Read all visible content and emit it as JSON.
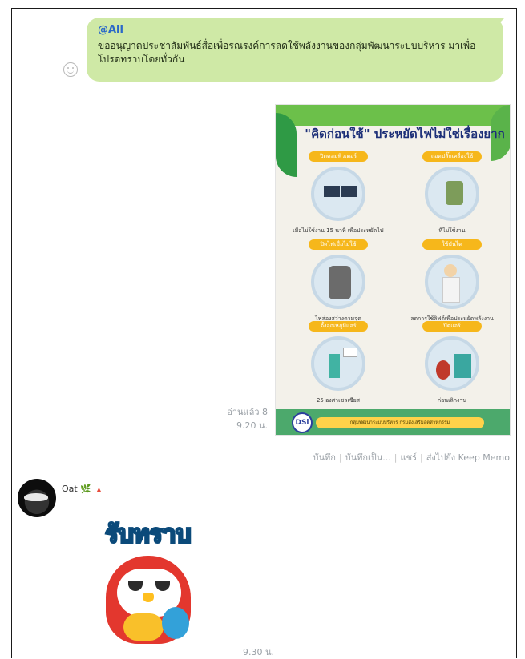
{
  "outgoing_message": {
    "mention": "@All",
    "text": "ขออนุญาตประชาสัมพันธ์สื่อเพื่อรณรงค์การลดใช้พลังงานของกลุ่มพัฒนาระบบบริหาร มาเพื่อโปรดทราบโดยทั่วกัน"
  },
  "poster": {
    "title": "\"คิดก่อนใช้\" ประหยัดไฟไม่ใช่เรื่องยาก",
    "items": [
      {
        "tag": "ปิดคอมพิวเตอร์",
        "caption": "เมื่อไม่ใช้งาน 15 นาที เพื่อประหยัดไฟ"
      },
      {
        "tag": "ถอดปลั๊กเครื่องใช้",
        "caption": "ที่ไม่ใช้งาน"
      },
      {
        "tag": "ปิดไฟเมื่อไม่ใช้",
        "caption": "ไฟส่องสว่างตามจุด"
      },
      {
        "tag": "ใช้บันได",
        "caption": "ลดการใช้ลิฟต์เพื่อประหยัดพลังงาน"
      },
      {
        "tag": "ตั้งอุณหภูมิแอร์",
        "caption": "25 องศาเซลเซียส"
      },
      {
        "tag": "ปิดแอร์",
        "caption": "ก่อนเลิกงาน"
      }
    ],
    "logo": "DSi",
    "footer": "กลุ่มพัฒนาระบบบริหาร กรมส่งเสริมอุตสาหกรรม"
  },
  "read_status": {
    "read": "อ่านแล้ว 8",
    "time": "9.20 น."
  },
  "actions": [
    "บันทึก",
    "บันทึกเป็น...",
    "แชร์",
    "ส่งไปยัง Keep Memo"
  ],
  "incoming": {
    "sender": "Oat",
    "sender_suffix": "🌿",
    "sticker_text": "รับทราบ",
    "time": "9.30 น."
  }
}
